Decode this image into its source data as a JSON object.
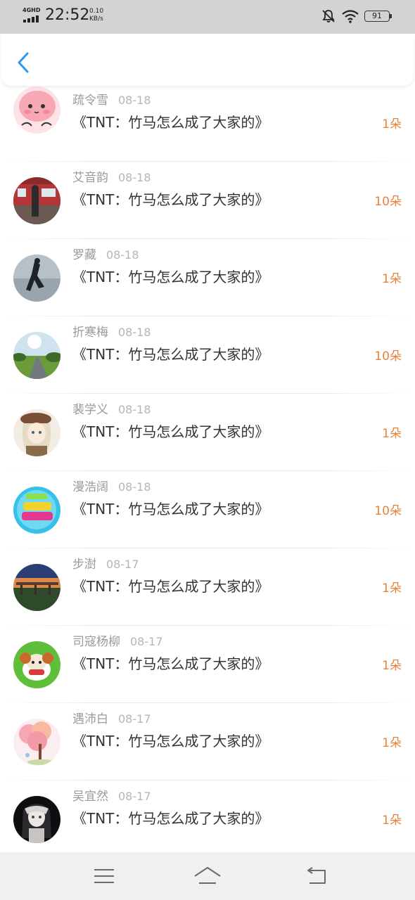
{
  "status_bar": {
    "network": "4GHD",
    "time": "22:52",
    "speed_value": "0.10",
    "speed_unit": "KB/s",
    "battery": "91",
    "icons": [
      "signal-icon",
      "mute-icon",
      "wifi-icon",
      "battery-icon"
    ]
  },
  "header": {
    "back_icon": "chevron-left-icon",
    "accent_color": "#2b9af3"
  },
  "list": {
    "count_color": "#e8833a",
    "items": [
      {
        "name": "疏令雪",
        "date": "08-18",
        "title": "《TNT：竹马怎么成了大家的》",
        "count": "1朵",
        "avatar": "pink-blob-avatar"
      },
      {
        "name": "艾音韵",
        "date": "08-18",
        "title": "《TNT：竹马怎么成了大家的》",
        "count": "10朵",
        "avatar": "train-photo-avatar"
      },
      {
        "name": "罗藏",
        "date": "08-18",
        "title": "《TNT：竹马怎么成了大家的》",
        "count": "1朵",
        "avatar": "dancer-photo-avatar"
      },
      {
        "name": "折寒梅",
        "date": "08-18",
        "title": "《TNT：竹马怎么成了大家的》",
        "count": "10朵",
        "avatar": "road-landscape-avatar"
      },
      {
        "name": "裴学义",
        "date": "08-18",
        "title": "《TNT：竹马怎么成了大家的》",
        "count": "1朵",
        "avatar": "anime-girl-avatar"
      },
      {
        "name": "漫浩阔",
        "date": "08-18",
        "title": "《TNT：竹马怎么成了大家的》",
        "count": "10朵",
        "avatar": "happy-new-year-avatar"
      },
      {
        "name": "步澍",
        "date": "08-17",
        "title": "《TNT：竹马怎么成了大家的》",
        "count": "1朵",
        "avatar": "bridge-sunset-avatar"
      },
      {
        "name": "司寇杨柳",
        "date": "08-17",
        "title": "《TNT：竹马怎么成了大家的》",
        "count": "1朵",
        "avatar": "sheep-cartoon-avatar"
      },
      {
        "name": "遇沛白",
        "date": "08-17",
        "title": "《TNT：竹马怎么成了大家的》",
        "count": "1朵",
        "avatar": "blossom-tree-avatar"
      },
      {
        "name": "吴宜然",
        "date": "08-17",
        "title": "《TNT：竹马怎么成了大家的》",
        "count": "1朵",
        "avatar": "dark-anime-girl-avatar"
      }
    ]
  },
  "nav_bar": {
    "buttons": [
      "menu-icon",
      "home-icon",
      "back-icon"
    ]
  }
}
